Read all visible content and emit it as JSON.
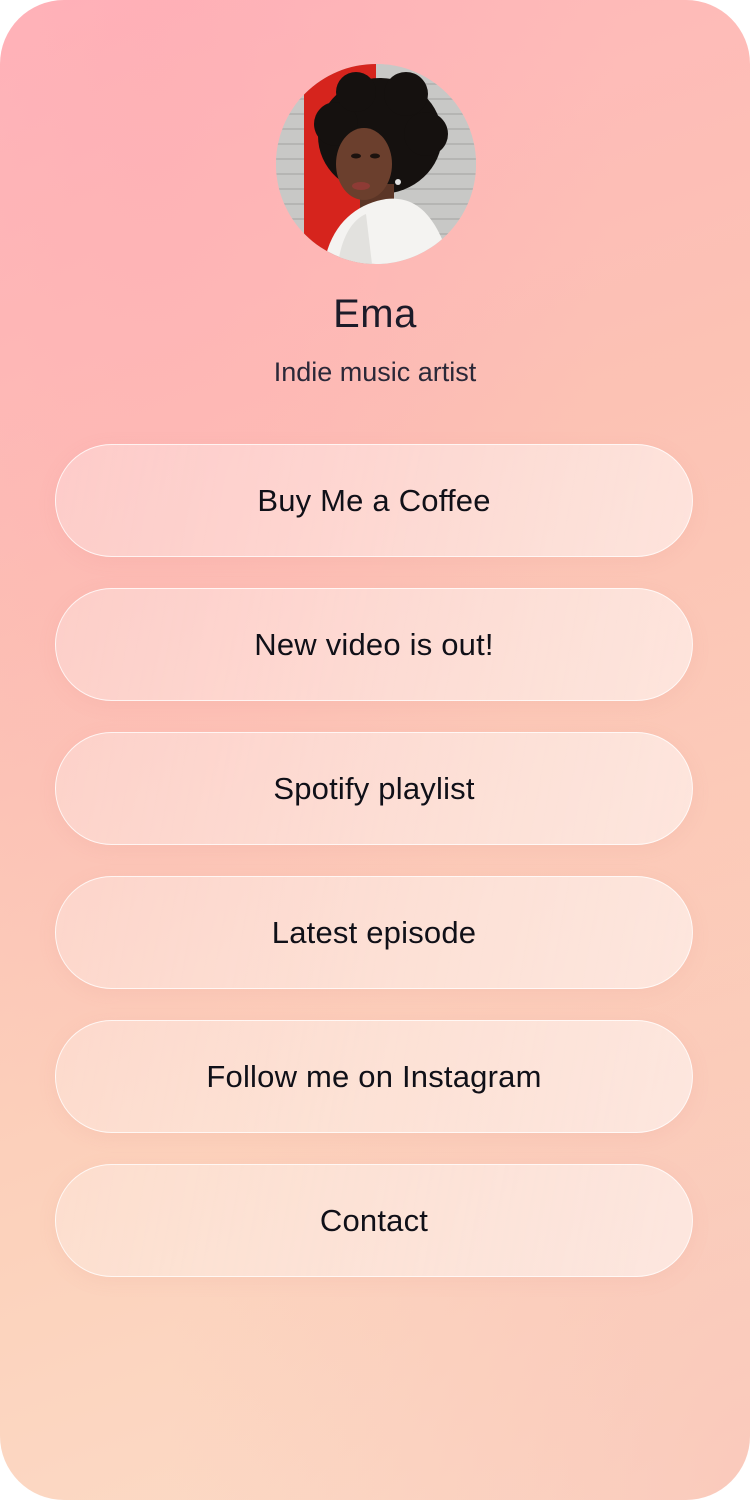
{
  "profile": {
    "name": "Ema",
    "tagline": "Indie music artist",
    "avatar_alt": "profile photo"
  },
  "links": [
    {
      "label": "Buy Me a Coffee"
    },
    {
      "label": "New video is out!"
    },
    {
      "label": "Spotify playlist"
    },
    {
      "label": "Latest episode"
    },
    {
      "label": "Follow me on Instagram"
    },
    {
      "label": "Contact"
    }
  ],
  "colors": {
    "background_top": "#ffb6bb",
    "background_bottom": "#fbdcc8",
    "text_primary": "#1c1b29",
    "button_border": "#ffffff"
  }
}
